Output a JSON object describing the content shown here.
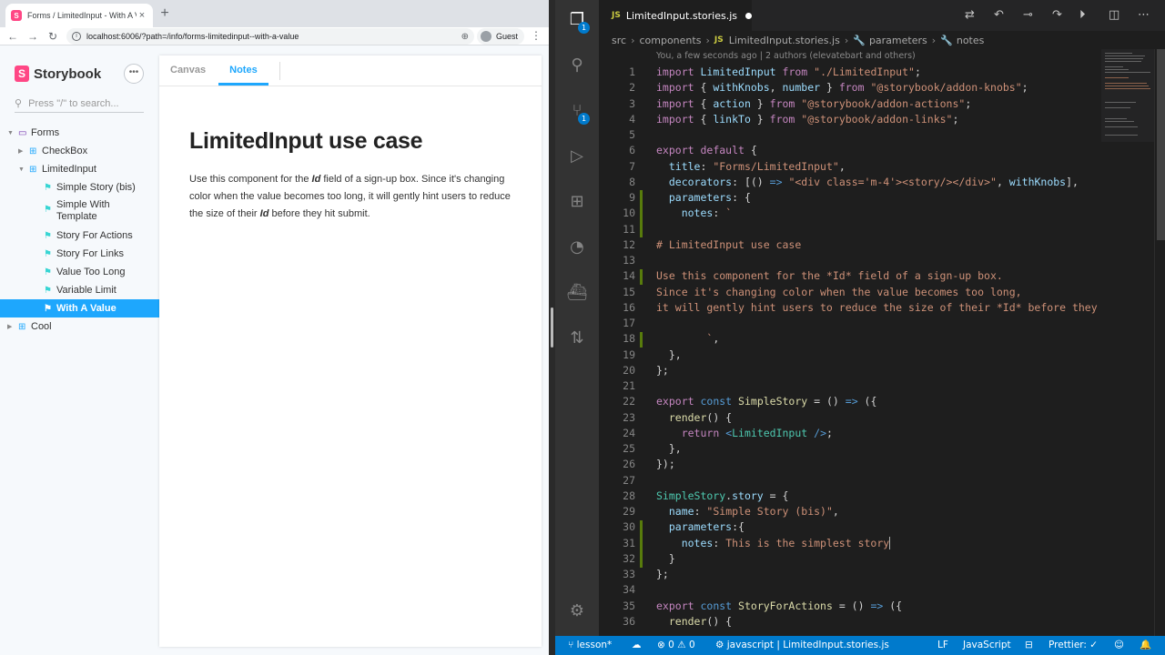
{
  "browser": {
    "tab_title": "Forms / LimitedInput - With A Va",
    "favicon_letter": "S",
    "close": "×",
    "new_tab": "+",
    "back": "←",
    "forward": "→",
    "reload": "↻",
    "info_icon": "i",
    "url": "localhost:6006/?path=/info/forms-limitedinput--with-a-value",
    "zoom_icon": "⊕",
    "profile": "Guest",
    "kebab": "⋮"
  },
  "storybook": {
    "brand": "Storybook",
    "logo_letter": "S",
    "menu": "•••",
    "search_icon": "⚲",
    "search_placeholder": "Press \"/\" to search...",
    "tree": [
      {
        "label": "Forms",
        "level": 0,
        "kind": "folder",
        "caret": "▼"
      },
      {
        "label": "CheckBox",
        "level": 1,
        "kind": "component",
        "caret": "▶"
      },
      {
        "label": "LimitedInput",
        "level": 1,
        "kind": "component",
        "caret": "▼"
      },
      {
        "label": "Simple Story (bis)",
        "level": 2,
        "kind": "story"
      },
      {
        "label": "Simple With Template",
        "level": 2,
        "kind": "story",
        "two_line": true,
        "line1": "Simple With",
        "line2": "Template"
      },
      {
        "label": "Story For Actions",
        "level": 2,
        "kind": "story"
      },
      {
        "label": "Story For Links",
        "level": 2,
        "kind": "story"
      },
      {
        "label": "Value Too Long",
        "level": 2,
        "kind": "story"
      },
      {
        "label": "Variable Limit",
        "level": 2,
        "kind": "story"
      },
      {
        "label": "With A Value",
        "level": 2,
        "kind": "story",
        "active": true
      },
      {
        "label": "Cool",
        "level": 0,
        "kind": "component",
        "caret": "▶"
      }
    ],
    "tabs": [
      "Canvas",
      "Notes"
    ],
    "active_tab": "Notes",
    "notes": {
      "heading": "LimitedInput use case",
      "p_before": "Use this component for the ",
      "em1": "Id",
      "p_mid": " field of a sign-up box. Since it's changing color when the value becomes too long, it will gently hint users to reduce the size of their ",
      "em2": "Id",
      "p_after": " before they hit submit."
    }
  },
  "vscode": {
    "tab": {
      "icon": "JS",
      "label": "LimitedInput.stories.js"
    },
    "breadcrumbs": [
      "src",
      "components",
      "LimitedInput.stories.js",
      "parameters",
      "notes"
    ],
    "breadcrumb_sep": "›",
    "blame": "You, a few seconds ago | 2 authors (elevatebart and others)",
    "activity": {
      "explorer_badge": "1",
      "scm_badge": "1",
      "icons": [
        "files-icon",
        "search-icon",
        "source-control-icon",
        "run-debug-icon",
        "extensions-icon",
        "git-graph-icon",
        "docker-icon",
        "pull-request-icon",
        "settings-gear-icon"
      ]
    },
    "line_numbers": [
      "1",
      "2",
      "3",
      "4",
      "5",
      "6",
      "7",
      "8",
      "9",
      "10",
      "11",
      "12",
      "13",
      "14",
      "15",
      "16",
      "17",
      "18",
      "19",
      "20",
      "21",
      "22",
      "23",
      "24",
      "25",
      "26",
      "27",
      "28",
      "29",
      "30",
      "31",
      "32",
      "33",
      "34",
      "35",
      "36"
    ],
    "status": {
      "branch": "lesson*",
      "errors": "0",
      "warnings": "0",
      "lang_context": "javascript",
      "file": "LimitedInput.stories.js",
      "eol": "LF",
      "language": "JavaScript",
      "prettier": "Prettier: ✓"
    },
    "accent": "#007acc"
  }
}
